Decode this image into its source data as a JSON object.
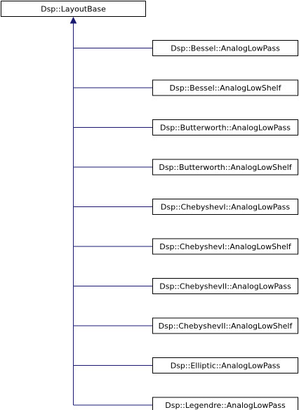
{
  "base_class": {
    "label": "Dsp::LayoutBase"
  },
  "derived_classes": [
    {
      "label": "Dsp::Bessel::AnalogLowPass"
    },
    {
      "label": "Dsp::Bessel::AnalogLowShelf"
    },
    {
      "label": "Dsp::Butterworth::AnalogLowPass"
    },
    {
      "label": "Dsp::Butterworth::AnalogLowShelf"
    },
    {
      "label": "Dsp::ChebyshevI::AnalogLowPass"
    },
    {
      "label": "Dsp::ChebyshevI::AnalogLowShelf"
    },
    {
      "label": "Dsp::ChebyshevII::AnalogLowPass"
    },
    {
      "label": "Dsp::ChebyshevII::AnalogLowShelf"
    },
    {
      "label": "Dsp::Elliptic::AnalogLowPass"
    },
    {
      "label": "Dsp::Legendre::AnalogLowPass"
    }
  ],
  "colors": {
    "edge": "#191970",
    "node_border": "#000000",
    "node_fill": "#ffffff",
    "text": "#000000"
  }
}
